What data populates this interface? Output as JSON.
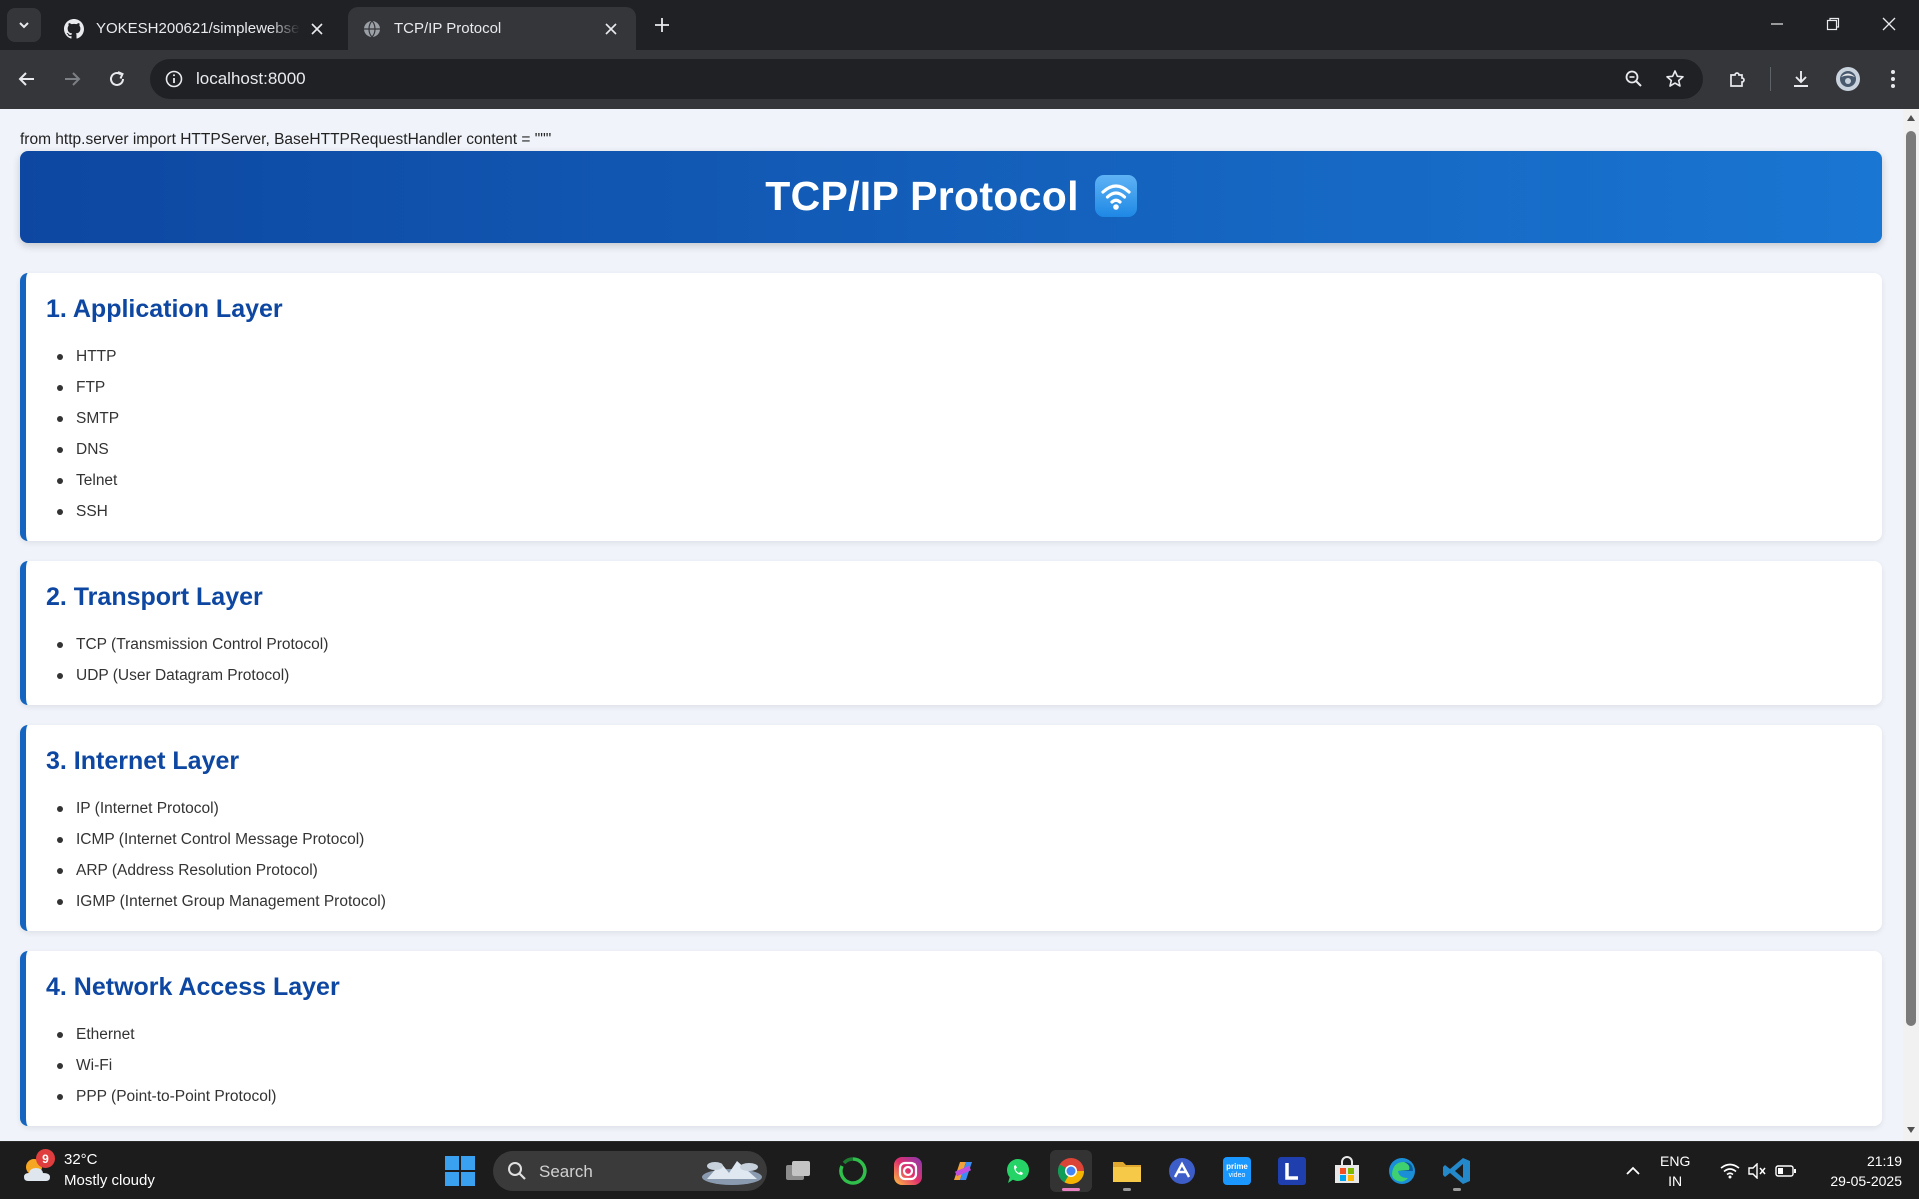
{
  "browser": {
    "tabs": [
      {
        "title": "YOKESH200621/simplewebserver",
        "active": false
      },
      {
        "title": "TCP/IP Protocol",
        "active": true
      }
    ],
    "address": "localhost:8000"
  },
  "page": {
    "code_text": "from http.server import HTTPServer, BaseHTTPRequestHandler content = \"\"\"",
    "title": "TCP/IP Protocol",
    "layers": [
      {
        "heading": "1. Application Layer",
        "items": [
          "HTTP",
          "FTP",
          "SMTP",
          "DNS",
          "Telnet",
          "SSH"
        ]
      },
      {
        "heading": "2. Transport Layer",
        "items": [
          "TCP (Transmission Control Protocol)",
          "UDP (User Datagram Protocol)"
        ]
      },
      {
        "heading": "3. Internet Layer",
        "items": [
          "IP (Internet Protocol)",
          "ICMP (Internet Control Message Protocol)",
          "ARP (Address Resolution Protocol)",
          "IGMP (Internet Group Management Protocol)"
        ]
      },
      {
        "heading": "4. Network Access Layer",
        "items": [
          "Ethernet",
          "Wi-Fi",
          "PPP (Point-to-Point Protocol)"
        ]
      }
    ]
  },
  "taskbar": {
    "weather": {
      "badge": "9",
      "temp": "32°C",
      "condition": "Mostly cloudy"
    },
    "search_label": "Search",
    "language": {
      "line1": "ENG",
      "line2": "IN"
    },
    "time": "21:19",
    "date": "29-05-2025"
  },
  "colors": {
    "header_gradient_start": "#0d47a1",
    "header_gradient_end": "#1976d2",
    "card_accent": "#1565c0",
    "heading_text": "#0d47a1",
    "page_background": "#f0f4fa"
  },
  "icons": [
    "tab-list-icon",
    "github-icon",
    "globe-icon",
    "close-icon",
    "plus-icon",
    "minimize-icon",
    "restore-icon",
    "back-icon",
    "forward-icon",
    "reload-icon",
    "info-icon",
    "zoom-icon",
    "star-icon",
    "extensions-icon",
    "download-icon",
    "profile-icon",
    "menu-icon",
    "wifi-icon",
    "windows-start-icon",
    "search-icon"
  ]
}
